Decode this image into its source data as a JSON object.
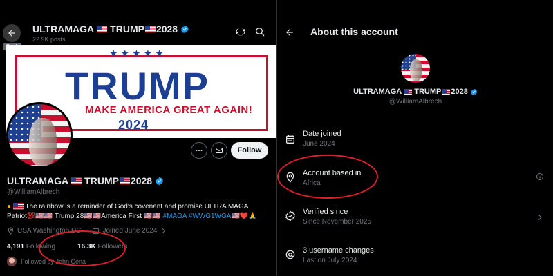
{
  "left": {
    "back_tooltip": "Back",
    "header_name": "ULTRAMAGA",
    "header_name_suffix": "TRUMP",
    "header_name_year": "2028",
    "posts_count": "22.9K posts",
    "banner": {
      "stars": "★★★★★",
      "word": "TRUMP",
      "slogan": "MAKE AMERICA GREAT AGAIN!",
      "year": "2024"
    },
    "follow_label": "Follow",
    "display_name": "ULTRAMAGA",
    "display_name_suffix": "TRUMP",
    "display_name_year": "2028",
    "handle": "@WilliamAlbrech",
    "bio_line1": "The rainbow is a reminder of God's covenant and promise ULTRA MAGA",
    "bio_line2_a": "Patriot💯🇺🇸🇺🇸 Trump 28🇺🇸🇺🇸America First 🇺🇸🇺🇸",
    "bio_tag1": "#MAGA",
    "bio_tag2": "#WWG1WGA",
    "bio_line2_end": "🇺🇸❤️🙏",
    "location": "USA  Washington DC",
    "joined": "Joined June 2024",
    "following_count": "4,191",
    "following_label": "Following",
    "followers_count": "16.3K",
    "followers_label": "Followers",
    "followed_by": "Followed by John Cena"
  },
  "right": {
    "title": "About this account",
    "name": "ULTRAMAGA",
    "name_suffix": "TRUMP",
    "name_year": "2028",
    "handle": "@WilliamAlbrech",
    "rows": [
      {
        "label": "Date joined",
        "value": "June 2024",
        "icon": "calendar-icon"
      },
      {
        "label": "Account based in",
        "value": "Africa",
        "icon": "location-pin-icon"
      },
      {
        "label": "Verified since",
        "value": "Since November 2025",
        "icon": "verified-check-icon"
      },
      {
        "label": "3 username changes",
        "value": "Last on July 2024",
        "icon": "at-sign-icon"
      }
    ]
  },
  "colors": {
    "accent": "#1d9bf0",
    "annotation": "#e01e2a",
    "banner_blue": "#1c3f94",
    "banner_red": "#c8102e"
  }
}
